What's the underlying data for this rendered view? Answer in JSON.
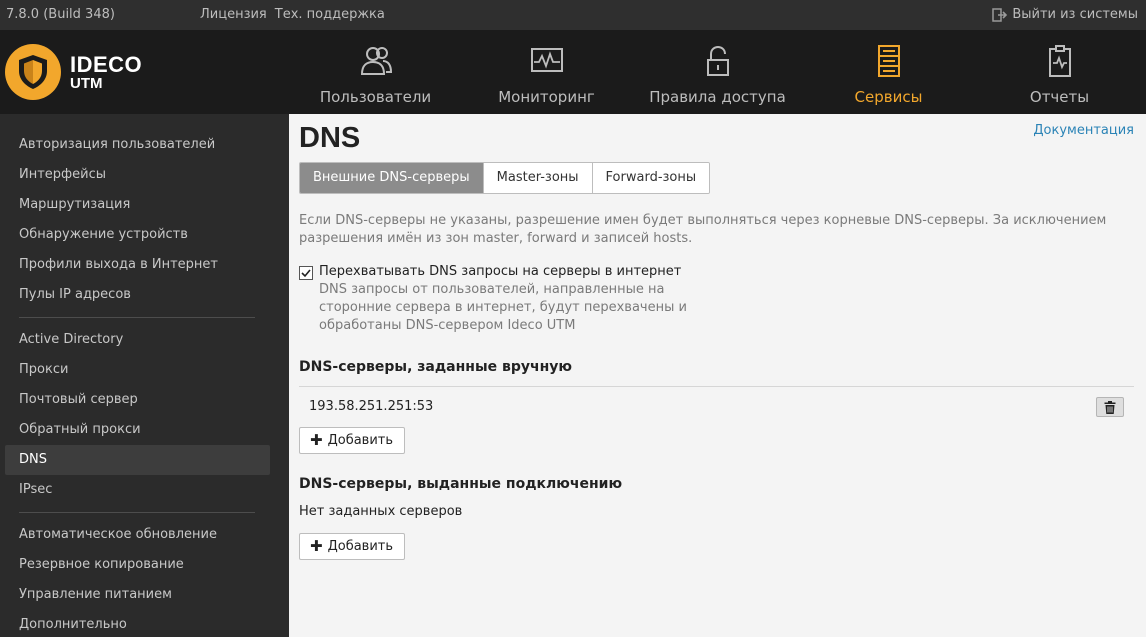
{
  "topbar": {
    "version": "7.8.0 (Build 348)",
    "links": [
      "Лицензия",
      "Тех. поддержка"
    ],
    "logout": "Выйти из системы"
  },
  "brand": {
    "line1": "IDECO",
    "line2": "UTM"
  },
  "nav": [
    {
      "label": "Пользователи",
      "icon": "users-icon"
    },
    {
      "label": "Мониторинг",
      "icon": "monitor-icon"
    },
    {
      "label": "Правила доступа",
      "icon": "lock-icon"
    },
    {
      "label": "Сервисы",
      "icon": "server-icon",
      "active": true
    },
    {
      "label": "Отчеты",
      "icon": "report-icon"
    }
  ],
  "sidebar": {
    "group1": [
      "Авторизация пользователей",
      "Интерфейсы",
      "Маршрутизация",
      "Обнаружение устройств",
      "Профили выхода в Интернет",
      "Пулы IP адресов"
    ],
    "group2": [
      "Active Directory",
      "Прокси",
      "Почтовый сервер",
      "Обратный прокси",
      "DNS",
      "IPsec"
    ],
    "group3": [
      "Автоматическое обновление",
      "Резервное копирование",
      "Управление питанием",
      "Дополнительно"
    ],
    "active": "DNS"
  },
  "main": {
    "title": "DNS",
    "doc_link": "Документация",
    "tabs": [
      "Внешние DNS-серверы",
      "Master-зоны",
      "Forward-зоны"
    ],
    "info": "Если DNS-серверы не указаны, разрешение имен будет выполняться через корневые DNS-серверы. За исключением разрешения имён из зон master, forward и записей hosts.",
    "intercept_label": "Перехватывать DNS запросы на серверы в интернет",
    "intercept_checked": true,
    "intercept_desc": "DNS запросы от пользователей, направленные на сторонние сервера в интернет, будут перехвачены и обработаны DNS-сервером Ideco UTM",
    "manual_title": "DNS-серверы, заданные вручную",
    "manual_servers": [
      "193.58.251.251:53"
    ],
    "add_label": "Добавить",
    "conn_title": "DNS-серверы, выданные подключению",
    "conn_empty": "Нет заданных серверов"
  },
  "colors": {
    "accent": "#f2a72c",
    "link": "#2a83b6",
    "tab_active": "#8c8c8c"
  }
}
